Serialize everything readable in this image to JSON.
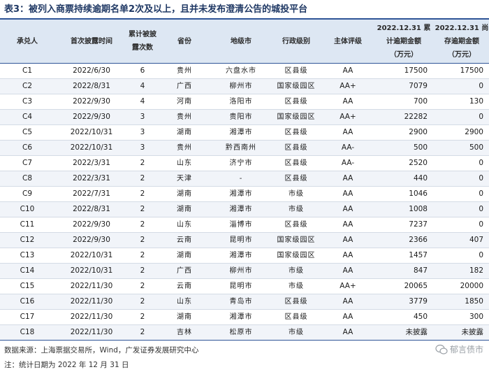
{
  "title": "表3：被列入商票持续逾期名单2次及以上，且并未发布澄清公告的城投平台",
  "header": {
    "acceptor": "承兑人",
    "first_date": "首次披露时间",
    "times_l1": "累计被披",
    "times_l2": "露次数",
    "province": "省份",
    "city": "地级市",
    "admin_level": "行政级别",
    "rating": "主体评级",
    "cum_l1": "2022.12.31 累",
    "cum_l2": "计逾期金额",
    "cum_l3": "（万元）",
    "out_l1": "2022.12.31 尚",
    "out_l2": "存逾期金额",
    "out_l3": "（万元）"
  },
  "rows": [
    {
      "id": "C1",
      "date": "2022/6/30",
      "times": "6",
      "prov": "贵州",
      "city": "六盘水市",
      "level": "区县级",
      "rating": "AA",
      "cum": "17500",
      "out": "17500"
    },
    {
      "id": "C2",
      "date": "2022/8/31",
      "times": "4",
      "prov": "广西",
      "city": "柳州市",
      "level": "国家级园区",
      "rating": "AA+",
      "cum": "7079",
      "out": "0"
    },
    {
      "id": "C3",
      "date": "2022/9/30",
      "times": "4",
      "prov": "河南",
      "city": "洛阳市",
      "level": "区县级",
      "rating": "AA",
      "cum": "700",
      "out": "130"
    },
    {
      "id": "C4",
      "date": "2022/9/30",
      "times": "3",
      "prov": "贵州",
      "city": "贵阳市",
      "level": "国家级园区",
      "rating": "AA+",
      "cum": "22282",
      "out": "0"
    },
    {
      "id": "C5",
      "date": "2022/10/31",
      "times": "3",
      "prov": "湖南",
      "city": "湘潭市",
      "level": "区县级",
      "rating": "AA",
      "cum": "2900",
      "out": "2900"
    },
    {
      "id": "C6",
      "date": "2022/10/31",
      "times": "3",
      "prov": "贵州",
      "city": "黔西南州",
      "level": "区县级",
      "rating": "AA-",
      "cum": "500",
      "out": "500"
    },
    {
      "id": "C7",
      "date": "2022/3/31",
      "times": "2",
      "prov": "山东",
      "city": "济宁市",
      "level": "区县级",
      "rating": "AA-",
      "cum": "2520",
      "out": "0"
    },
    {
      "id": "C8",
      "date": "2022/3/31",
      "times": "2",
      "prov": "天津",
      "city": "-",
      "level": "区县级",
      "rating": "AA",
      "cum": "440",
      "out": "0"
    },
    {
      "id": "C9",
      "date": "2022/7/31",
      "times": "2",
      "prov": "湖南",
      "city": "湘潭市",
      "level": "市级",
      "rating": "AA",
      "cum": "1046",
      "out": "0"
    },
    {
      "id": "C10",
      "date": "2022/8/31",
      "times": "2",
      "prov": "湖南",
      "city": "湘潭市",
      "level": "市级",
      "rating": "AA",
      "cum": "1008",
      "out": "0"
    },
    {
      "id": "C11",
      "date": "2022/9/30",
      "times": "2",
      "prov": "山东",
      "city": "淄博市",
      "level": "区县级",
      "rating": "AA",
      "cum": "7237",
      "out": "0"
    },
    {
      "id": "C12",
      "date": "2022/9/30",
      "times": "2",
      "prov": "云南",
      "city": "昆明市",
      "level": "国家级园区",
      "rating": "AA",
      "cum": "2366",
      "out": "407"
    },
    {
      "id": "C13",
      "date": "2022/10/31",
      "times": "2",
      "prov": "湖南",
      "city": "湘潭市",
      "level": "国家级园区",
      "rating": "AA",
      "cum": "1457",
      "out": "0"
    },
    {
      "id": "C14",
      "date": "2022/10/31",
      "times": "2",
      "prov": "广西",
      "city": "柳州市",
      "level": "市级",
      "rating": "AA",
      "cum": "847",
      "out": "182"
    },
    {
      "id": "C15",
      "date": "2022/11/30",
      "times": "2",
      "prov": "云南",
      "city": "昆明市",
      "level": "市级",
      "rating": "AA+",
      "cum": "20065",
      "out": "20000"
    },
    {
      "id": "C16",
      "date": "2022/11/30",
      "times": "2",
      "prov": "山东",
      "city": "青岛市",
      "level": "区县级",
      "rating": "AA",
      "cum": "3779",
      "out": "1850"
    },
    {
      "id": "C17",
      "date": "2022/11/30",
      "times": "2",
      "prov": "湖南",
      "city": "湘潭市",
      "level": "区县级",
      "rating": "AA",
      "cum": "450",
      "out": "300"
    },
    {
      "id": "C18",
      "date": "2022/11/30",
      "times": "2",
      "prov": "吉林",
      "city": "松原市",
      "level": "市级",
      "rating": "AA",
      "cum": "未披露",
      "out": "未披露"
    }
  ],
  "footer": {
    "source": "数据来源：上海票据交易所，Wind，广发证券发展研究中心",
    "note": "注：统计日期为 2022 年 12 月 31 日",
    "watermark": "郁言债市"
  }
}
